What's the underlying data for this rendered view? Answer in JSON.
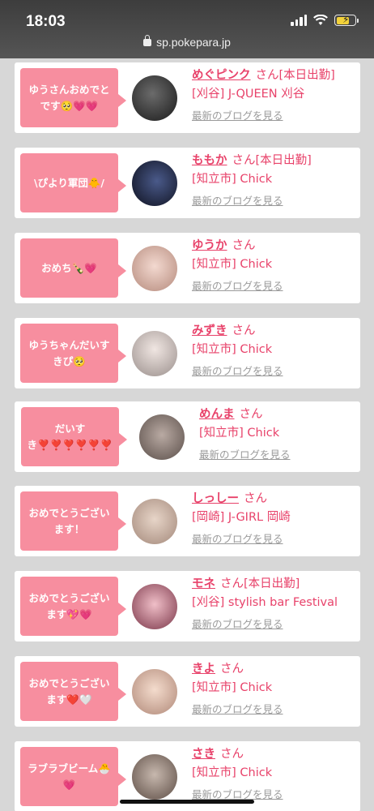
{
  "status_bar": {
    "time": "18:03",
    "url": "sp.pokepara.jp"
  },
  "colors": {
    "accent": "#e8426a",
    "bubble": "#f78e9f",
    "link_gray": "#9a9a9a"
  },
  "feed": {
    "items": [
      {
        "message": "ゆうさんおめでとです🥺💗💗",
        "name": "めぐピンク",
        "suffix": "さん[本日出勤]",
        "shop": "[刈谷] J-QUEEN 刈谷",
        "blog": "最新のブログを見る"
      },
      {
        "message": "\\ぴより軍団🐥/",
        "name": "ももか",
        "suffix": "さん[本日出勤]",
        "shop": "[知立市] Chick",
        "blog": "最新のブログを見る"
      },
      {
        "message": "おめち🍾💗",
        "name": "ゆうか",
        "suffix": "さん",
        "shop": "[知立市] Chick",
        "blog": "最新のブログを見る"
      },
      {
        "message": "ゆうちゃんだいすきぴ🥺",
        "name": "みずき",
        "suffix": "さん",
        "shop": "[知立市] Chick",
        "blog": "最新のブログを見る"
      },
      {
        "message": "だいすき❣️❣️❣️❣️❣️❣️",
        "name": "めんま",
        "suffix": "さん",
        "shop": "[知立市] Chick",
        "blog": "最新のブログを見る"
      },
      {
        "message": "おめでとうございます！",
        "name": "しっしー",
        "suffix": "さん",
        "shop": "[岡崎] J-GIRL 岡崎",
        "blog": "最新のブログを見る"
      },
      {
        "message": "おめでとうございます💖💗",
        "name": "モネ",
        "suffix": "さん[本日出勤]",
        "shop": "[刈谷] stylish bar Festival",
        "blog": "最新のブログを見る"
      },
      {
        "message": "おめでとうございます❤️🤍",
        "name": "きよ",
        "suffix": "さん",
        "shop": "[知立市] Chick",
        "blog": "最新のブログを見る"
      },
      {
        "message": "ラブラブビーム🐣💗",
        "name": "さき",
        "suffix": "さん",
        "shop": "[知立市] Chick",
        "blog": "最新のブログを見る"
      }
    ]
  }
}
